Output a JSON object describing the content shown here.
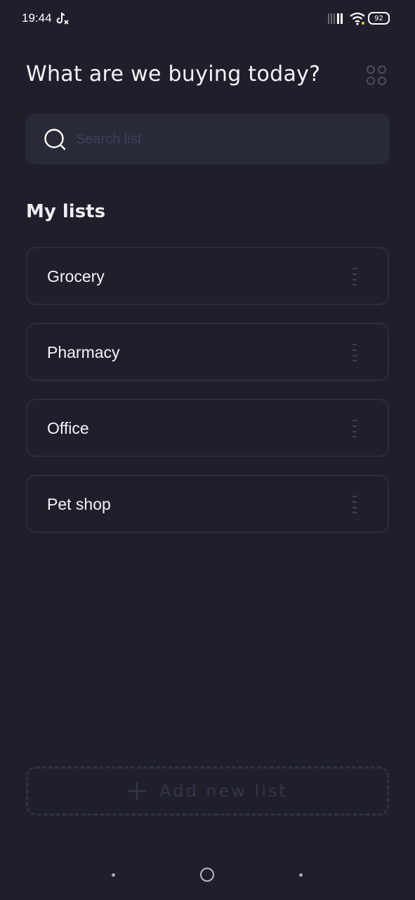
{
  "status_bar": {
    "time": "19:44",
    "battery": "92"
  },
  "header": {
    "title": "What are we buying today?"
  },
  "search": {
    "placeholder": "Search list",
    "value": ""
  },
  "section": {
    "title": "My lists"
  },
  "lists": [
    {
      "label": "Grocery"
    },
    {
      "label": "Pharmacy"
    },
    {
      "label": "Office"
    },
    {
      "label": "Pet shop"
    }
  ],
  "add_button": {
    "label": "Add new list"
  },
  "colors": {
    "background": "#1f1f2c",
    "card_border": "#2b2d3d",
    "search_bg": "#282a39"
  },
  "icons": [
    "tiktok-icon",
    "signal-icon",
    "wifi-icon",
    "grid-icon",
    "search-icon",
    "drag-handle-icon",
    "plus-icon"
  ]
}
